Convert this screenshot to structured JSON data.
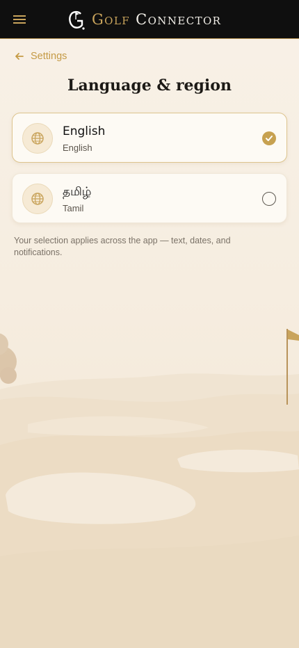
{
  "header": {
    "brand_word1": "Golf",
    "brand_word2": "Connector",
    "brand_color": "#c9a45c",
    "background": "#0f0f0f"
  },
  "nav": {
    "back_label": "Settings",
    "back_icon": "arrow-left-icon",
    "menu_icon": "hamburger-menu-icon"
  },
  "page": {
    "title": "Language & region",
    "note": "Your selection applies across the app — text, dates, and notifications."
  },
  "languages": [
    {
      "name": "English",
      "sublabel": "English",
      "selected": true,
      "icon": "globe-icon"
    },
    {
      "name": "தமிழ்",
      "sublabel": "Tamil",
      "selected": false,
      "icon": "globe-icon"
    }
  ],
  "colors": {
    "accent": "#c7a150",
    "page_bg": "#f7efe4"
  }
}
